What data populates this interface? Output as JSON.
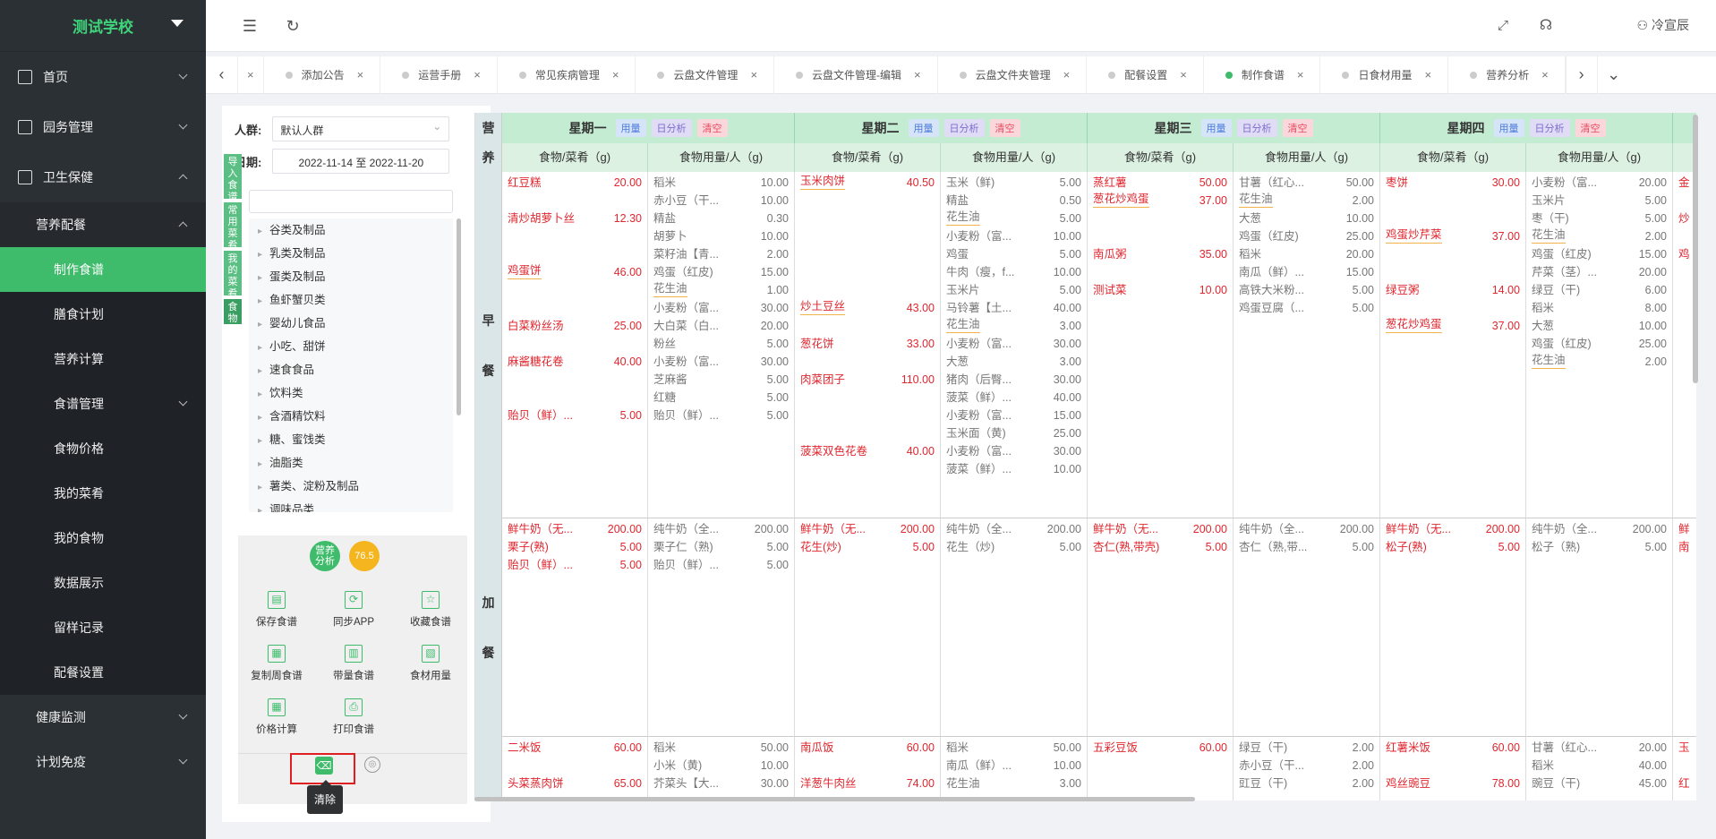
{
  "app": {
    "logo": "测试学校",
    "user": "冷宣辰"
  },
  "sidebar": {
    "items": [
      {
        "label": "首页",
        "level": 1,
        "chevron": "down",
        "icon": "home-icon"
      },
      {
        "label": "园务管理",
        "level": 1,
        "chevron": "down",
        "icon": "bank-icon"
      },
      {
        "label": "卫生保健",
        "level": 1,
        "chevron": "up",
        "icon": "clipboard-icon"
      },
      {
        "label": "营养配餐",
        "level": 2,
        "chevron": "up"
      },
      {
        "label": "制作食谱",
        "level": 3,
        "active": true
      },
      {
        "label": "膳食计划",
        "level": 3
      },
      {
        "label": "营养计算",
        "level": 3
      },
      {
        "label": "食谱管理",
        "level": 3,
        "chevron": "down"
      },
      {
        "label": "食物价格",
        "level": 3
      },
      {
        "label": "我的菜肴",
        "level": 3
      },
      {
        "label": "我的食物",
        "level": 3
      },
      {
        "label": "数据展示",
        "level": 3
      },
      {
        "label": "留样记录",
        "level": 3
      },
      {
        "label": "配餐设置",
        "level": 3
      },
      {
        "label": "健康监测",
        "level": 2,
        "chevron": "down"
      },
      {
        "label": "计划免疫",
        "level": 2,
        "chevron": "down"
      }
    ]
  },
  "tabs": [
    {
      "label": "添加公告"
    },
    {
      "label": "运营手册"
    },
    {
      "label": "常见疾病管理"
    },
    {
      "label": "云盘文件管理"
    },
    {
      "label": "云盘文件管理-编辑"
    },
    {
      "label": "云盘文件夹管理"
    },
    {
      "label": "配餐设置"
    },
    {
      "label": "制作食谱",
      "active": true
    },
    {
      "label": "日食材用量"
    },
    {
      "label": "营养分析"
    }
  ],
  "filters": {
    "crowd_label": "人群:",
    "crowd_value": "默认人群",
    "date_label": "日期:",
    "date_value": "2022-11-14 至 2022-11-20"
  },
  "vtabs": [
    "导入食谱",
    "常用菜肴",
    "我的菜肴",
    "食物"
  ],
  "categories": [
    "谷类及制品",
    "乳类及制品",
    "蛋类及制品",
    "鱼虾蟹贝类",
    "婴幼儿食品",
    "小吃、甜饼",
    "速食食品",
    "饮料类",
    "含酒精饮料",
    "糖、蜜饯类",
    "油脂类",
    "薯类、淀粉及制品",
    "调味品类"
  ],
  "badges": {
    "analysis": "营养\n分析",
    "score": "76.5"
  },
  "actions": [
    "保存食谱",
    "同步APP",
    "收藏食谱",
    "复制周食谱",
    "带量食谱",
    "食材用量",
    "价格计算",
    "打印食谱"
  ],
  "tooltip": "清除",
  "grid": {
    "corner": [
      "营",
      "养"
    ],
    "col_food": "食物/菜肴（g)",
    "col_amount": "食物用量/人（g)",
    "pill_usage": "用量",
    "pill_day": "日分析",
    "pill_clear": "清空",
    "days": [
      "星期一",
      "星期二",
      "星期三",
      "星期四"
    ],
    "rows": [
      {
        "label": [
          "早",
          "餐"
        ]
      },
      {
        "label": [
          "加",
          "餐"
        ]
      }
    ],
    "breakfast": [
      {
        "dishes": [
          {
            "name": "红豆糕",
            "g": "20.00",
            "ul": false,
            "row": 0
          },
          {
            "name": "清炒胡萝卜丝",
            "g": "12.30",
            "ul": false,
            "row": 2
          },
          {
            "name": "鸡蛋饼",
            "g": "46.00",
            "ul": true,
            "row": 5
          },
          {
            "name": "白菜粉丝汤",
            "g": "25.00",
            "ul": false,
            "row": 8
          },
          {
            "name": "麻酱糖花卷",
            "g": "40.00",
            "ul": false,
            "row": 10
          },
          {
            "name": "贻贝（鲜）...",
            "g": "5.00",
            "ul": false,
            "row": 13
          }
        ],
        "ingredients": [
          {
            "name": "稻米",
            "g": "10.00"
          },
          {
            "name": "赤小豆（干...",
            "g": "10.00"
          },
          {
            "name": "精盐",
            "g": "0.30"
          },
          {
            "name": "胡萝卜",
            "g": "10.00"
          },
          {
            "name": "菜籽油【青...",
            "g": "2.00"
          },
          {
            "name": "鸡蛋（红皮)",
            "g": "15.00"
          },
          {
            "name": "花生油",
            "g": "1.00",
            "ul": true
          },
          {
            "name": "小麦粉（富...",
            "g": "30.00"
          },
          {
            "name": "大白菜（白...",
            "g": "20.00"
          },
          {
            "name": "粉丝",
            "g": "5.00"
          },
          {
            "name": "小麦粉（富...",
            "g": "30.00"
          },
          {
            "name": "芝麻酱",
            "g": "5.00"
          },
          {
            "name": "红糖",
            "g": "5.00"
          },
          {
            "name": "贻贝（鲜）...",
            "g": "5.00"
          }
        ]
      },
      {
        "dishes": [
          {
            "name": "玉米肉饼",
            "g": "40.50",
            "ul": true,
            "row": 0
          },
          {
            "name": "炒土豆丝",
            "g": "43.00",
            "ul": true,
            "row": 7
          },
          {
            "name": "葱花饼",
            "g": "33.00",
            "ul": false,
            "row": 9
          },
          {
            "name": "肉菜团子",
            "g": "110.00",
            "ul": false,
            "row": 11
          },
          {
            "name": "菠菜双色花卷",
            "g": "40.00",
            "ul": false,
            "row": 15
          }
        ],
        "ingredients": [
          {
            "name": "玉米（鲜)",
            "g": "5.00"
          },
          {
            "name": "精盐",
            "g": "0.50"
          },
          {
            "name": "花生油",
            "g": "5.00",
            "ul": true
          },
          {
            "name": "小麦粉（富...",
            "g": "10.00"
          },
          {
            "name": "鸡蛋",
            "g": "5.00"
          },
          {
            "name": "牛肉（瘦，f...",
            "g": "10.00"
          },
          {
            "name": "玉米片",
            "g": "5.00"
          },
          {
            "name": "马铃薯【土...",
            "g": "40.00"
          },
          {
            "name": "花生油",
            "g": "3.00",
            "ul": true
          },
          {
            "name": "小麦粉（富...",
            "g": "30.00"
          },
          {
            "name": "大葱",
            "g": "3.00"
          },
          {
            "name": "猪肉（后臀...",
            "g": "30.00"
          },
          {
            "name": "菠菜（鲜）...",
            "g": "40.00"
          },
          {
            "name": "小麦粉（富...",
            "g": "15.00"
          },
          {
            "name": "玉米面（黄)",
            "g": "25.00"
          },
          {
            "name": "小麦粉（富...",
            "g": "30.00"
          },
          {
            "name": "菠菜（鲜）...",
            "g": "10.00"
          }
        ]
      },
      {
        "dishes": [
          {
            "name": "蒸红薯",
            "g": "50.00",
            "ul": false,
            "row": 0
          },
          {
            "name": "葱花炒鸡蛋",
            "g": "37.00",
            "ul": true,
            "row": 1
          },
          {
            "name": "南瓜粥",
            "g": "35.00",
            "ul": false,
            "row": 4
          },
          {
            "name": "测试菜",
            "g": "10.00",
            "ul": false,
            "row": 6
          }
        ],
        "ingredients": [
          {
            "name": "甘薯（红心...",
            "g": "50.00"
          },
          {
            "name": "花生油",
            "g": "2.00",
            "ul": true
          },
          {
            "name": "大葱",
            "g": "10.00"
          },
          {
            "name": "鸡蛋（红皮)",
            "g": "25.00"
          },
          {
            "name": "稻米",
            "g": "20.00"
          },
          {
            "name": "南瓜（鲜）...",
            "g": "15.00"
          },
          {
            "name": "高铁大米粉...",
            "g": "5.00"
          },
          {
            "name": "鸡蛋豆腐（...",
            "g": "5.00"
          }
        ]
      },
      {
        "dishes": [
          {
            "name": "枣饼",
            "g": "30.00",
            "ul": false,
            "row": 0
          },
          {
            "name": "鸡蛋炒芹菜",
            "g": "37.00",
            "ul": true,
            "row": 3
          },
          {
            "name": "绿豆粥",
            "g": "14.00",
            "ul": false,
            "row": 6
          },
          {
            "name": "葱花炒鸡蛋",
            "g": "37.00",
            "ul": true,
            "row": 8
          }
        ],
        "ingredients": [
          {
            "name": "小麦粉（富...",
            "g": "20.00"
          },
          {
            "name": "玉米片",
            "g": "5.00"
          },
          {
            "name": "枣（干)",
            "g": "5.00"
          },
          {
            "name": "花生油",
            "g": "2.00",
            "ul": true
          },
          {
            "name": "鸡蛋（红皮)",
            "g": "15.00"
          },
          {
            "name": "芹菜（茎）...",
            "g": "20.00"
          },
          {
            "name": "绿豆（干)",
            "g": "6.00"
          },
          {
            "name": "稻米",
            "g": "8.00"
          },
          {
            "name": "大葱",
            "g": "10.00"
          },
          {
            "name": "鸡蛋（红皮)",
            "g": "25.00"
          },
          {
            "name": "花生油",
            "g": "2.00",
            "ul": true
          }
        ]
      }
    ],
    "breakfast_edge": [
      "金",
      "",
      "炒",
      "",
      "鸡"
    ],
    "snack": [
      {
        "dishes": [
          {
            "name": "鲜牛奶（无...",
            "g": "200.00"
          },
          {
            "name": "栗子(熟)",
            "g": "5.00"
          },
          {
            "name": "贻贝（鲜）...",
            "g": "5.00"
          }
        ],
        "ingredients": [
          {
            "name": "纯牛奶（全...",
            "g": "200.00"
          },
          {
            "name": "栗子仁（熟)",
            "g": "5.00"
          },
          {
            "name": "贻贝（鲜）...",
            "g": "5.00"
          }
        ]
      },
      {
        "dishes": [
          {
            "name": "鲜牛奶（无...",
            "g": "200.00"
          },
          {
            "name": "花生(炒)",
            "g": "5.00"
          }
        ],
        "ingredients": [
          {
            "name": "纯牛奶（全...",
            "g": "200.00"
          },
          {
            "name": "花生（炒)",
            "g": "5.00"
          }
        ]
      },
      {
        "dishes": [
          {
            "name": "鲜牛奶（无...",
            "g": "200.00"
          },
          {
            "name": "杏仁(熟,带壳)",
            "g": "5.00"
          }
        ],
        "ingredients": [
          {
            "name": "纯牛奶（全...",
            "g": "200.00"
          },
          {
            "name": "杏仁（熟,带...",
            "g": "5.00"
          }
        ]
      },
      {
        "dishes": [
          {
            "name": "鲜牛奶（无...",
            "g": "200.00"
          },
          {
            "name": "松子(熟)",
            "g": "5.00"
          }
        ],
        "ingredients": [
          {
            "name": "纯牛奶（全...",
            "g": "200.00"
          },
          {
            "name": "松子（熟)",
            "g": "5.00"
          }
        ]
      }
    ],
    "snack_edge": [
      "鲜",
      "南"
    ],
    "lunch": [
      {
        "dishes": [
          {
            "name": "二米饭",
            "g": "60.00",
            "row": 0
          },
          {
            "name": "头菜蒸肉饼",
            "g": "65.00",
            "row": 2
          }
        ],
        "ingredients": [
          {
            "name": "稻米",
            "g": "50.00"
          },
          {
            "name": "小米（黄)",
            "g": "10.00"
          },
          {
            "name": "芥菜头【大...",
            "g": "30.00"
          }
        ]
      },
      {
        "dishes": [
          {
            "name": "南瓜饭",
            "g": "60.00",
            "row": 0
          },
          {
            "name": "洋葱牛肉丝",
            "g": "74.00",
            "row": 2
          }
        ],
        "ingredients": [
          {
            "name": "稻米",
            "g": "50.00"
          },
          {
            "name": "南瓜（鲜）...",
            "g": "10.00"
          },
          {
            "name": "花生油",
            "g": "3.00"
          }
        ]
      },
      {
        "dishes": [
          {
            "name": "五彩豆饭",
            "g": "60.00",
            "row": 0
          }
        ],
        "ingredients": [
          {
            "name": "绿豆（干)",
            "g": "2.00"
          },
          {
            "name": "赤小豆（干...",
            "g": "2.00"
          },
          {
            "name": "豇豆（干)",
            "g": "2.00"
          }
        ]
      },
      {
        "dishes": [
          {
            "name": "红薯米饭",
            "g": "60.00",
            "row": 0
          },
          {
            "name": "鸡丝豌豆",
            "g": "78.00",
            "row": 2
          }
        ],
        "ingredients": [
          {
            "name": "甘薯（红心...",
            "g": "20.00"
          },
          {
            "name": "稻米",
            "g": "40.00"
          },
          {
            "name": "豌豆（干)",
            "g": "45.00"
          }
        ]
      }
    ],
    "lunch_edge": [
      "玉",
      "",
      "红"
    ]
  }
}
